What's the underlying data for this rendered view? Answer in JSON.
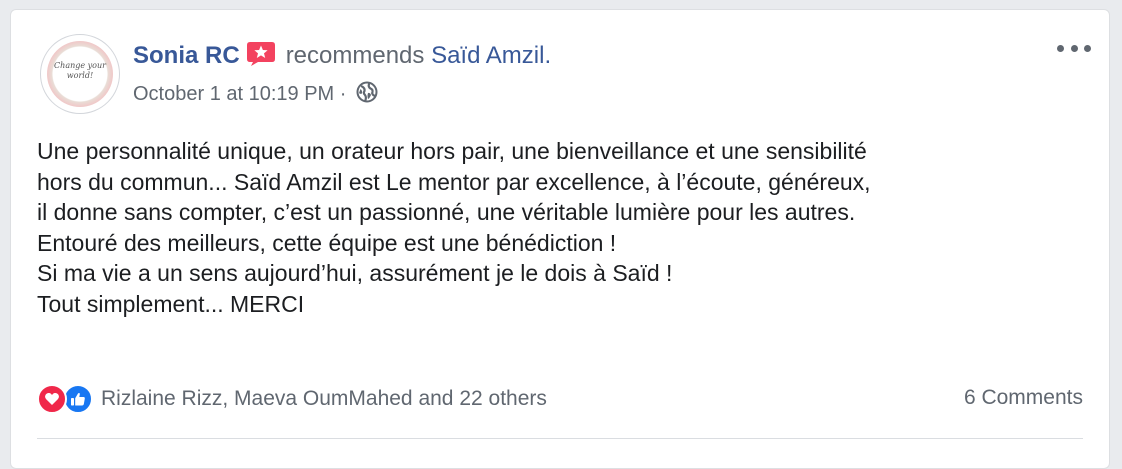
{
  "post": {
    "author": "Sonia RC",
    "action": "recommends",
    "page": "Saïd Amzil.",
    "timestamp": "October 1 at 10:19 PM",
    "separator": "·",
    "privacy_icon": "globe-icon",
    "badge_icon": "recommend-star-icon",
    "avatar_text": "Change your world!",
    "body_lines": [
      "Une personnalité unique, un orateur hors pair, une bienveillance et une sensibilité",
      "hors du commun... Saïd Amzil est Le mentor par excellence, à l’écoute, généreux,",
      "il donne sans compter, c’est un passionné, une véritable lumière pour les autres.",
      "Entouré des meilleurs, cette équipe est une bénédiction !",
      "Si ma vie a un sens aujourd’hui, assurément je le dois à Saïd !",
      "Tout simplement... MERCI"
    ]
  },
  "reactions": {
    "icons": [
      "love-reaction-icon",
      "like-reaction-icon"
    ],
    "names": "Rizlaine Rizz, Maeva OumMahed and 22 others"
  },
  "comments": {
    "label": "6 Comments"
  },
  "colors": {
    "link": "#385898",
    "meta": "#606770",
    "text": "#1c1e21",
    "badge": "#f3425f",
    "love": "#f0284a",
    "like": "#1877f2"
  }
}
